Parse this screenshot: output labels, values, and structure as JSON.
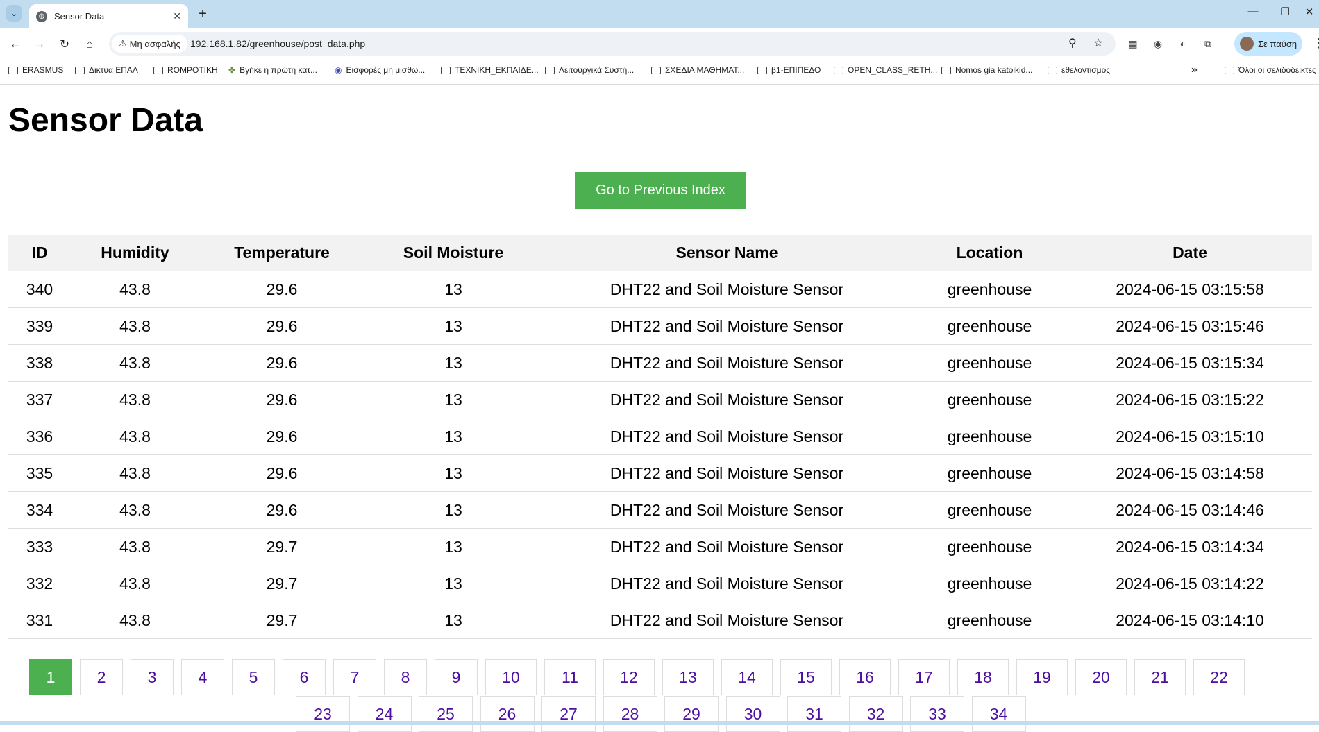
{
  "browser": {
    "tab_title": "Sensor Data",
    "security_label": "Μη ασφαλής",
    "url": "192.168.1.82/greenhouse/post_data.php",
    "profile_label": "Σε παύση",
    "bookmarks": [
      "ERASMUS",
      "Δικτυα ΕΠΑΛ",
      "ROMPOTIKH",
      "Βγήκε η πρώτη κατ...",
      "Εισφορές μη μισθω...",
      "ΤΕΧΝΙΚΗ_ΕΚΠΑΙΔΕ...",
      "Λειτουργικά Συστή...",
      "ΣΧΕΔΙΑ ΜΑΘΗΜΑΤ...",
      "β1-ΕΠΙΠΕΔΟ",
      "OPEN_CLASS_RETH...",
      "Nomos gia katoikid...",
      "εθελοντισμος"
    ],
    "all_bookmarks_label": "Όλοι οι σελιδοδείκτες"
  },
  "page": {
    "heading": "Sensor Data",
    "prev_button": "Go to Previous Index"
  },
  "table": {
    "headers": [
      "ID",
      "Humidity",
      "Temperature",
      "Soil Moisture",
      "Sensor Name",
      "Location",
      "Date"
    ],
    "rows": [
      [
        "340",
        "43.8",
        "29.6",
        "13",
        "DHT22 and Soil Moisture Sensor",
        "greenhouse",
        "2024-06-15 03:15:58"
      ],
      [
        "339",
        "43.8",
        "29.6",
        "13",
        "DHT22 and Soil Moisture Sensor",
        "greenhouse",
        "2024-06-15 03:15:46"
      ],
      [
        "338",
        "43.8",
        "29.6",
        "13",
        "DHT22 and Soil Moisture Sensor",
        "greenhouse",
        "2024-06-15 03:15:34"
      ],
      [
        "337",
        "43.8",
        "29.6",
        "13",
        "DHT22 and Soil Moisture Sensor",
        "greenhouse",
        "2024-06-15 03:15:22"
      ],
      [
        "336",
        "43.8",
        "29.6",
        "13",
        "DHT22 and Soil Moisture Sensor",
        "greenhouse",
        "2024-06-15 03:15:10"
      ],
      [
        "335",
        "43.8",
        "29.6",
        "13",
        "DHT22 and Soil Moisture Sensor",
        "greenhouse",
        "2024-06-15 03:14:58"
      ],
      [
        "334",
        "43.8",
        "29.6",
        "13",
        "DHT22 and Soil Moisture Sensor",
        "greenhouse",
        "2024-06-15 03:14:46"
      ],
      [
        "333",
        "43.8",
        "29.7",
        "13",
        "DHT22 and Soil Moisture Sensor",
        "greenhouse",
        "2024-06-15 03:14:34"
      ],
      [
        "332",
        "43.8",
        "29.7",
        "13",
        "DHT22 and Soil Moisture Sensor",
        "greenhouse",
        "2024-06-15 03:14:22"
      ],
      [
        "331",
        "43.8",
        "29.7",
        "13",
        "DHT22 and Soil Moisture Sensor",
        "greenhouse",
        "2024-06-15 03:14:10"
      ]
    ]
  },
  "pagination": {
    "current": "1",
    "pages": [
      "1",
      "2",
      "3",
      "4",
      "5",
      "6",
      "7",
      "8",
      "9",
      "10",
      "11",
      "12",
      "13",
      "14",
      "15",
      "16",
      "17",
      "18",
      "19",
      "20",
      "21",
      "22",
      "23",
      "24",
      "25",
      "26",
      "27",
      "28",
      "29",
      "30",
      "31",
      "32",
      "33",
      "34"
    ]
  },
  "colors": {
    "accent": "#4caf50",
    "link": "#4b0fa0",
    "header_bg": "#f2f2f2"
  }
}
